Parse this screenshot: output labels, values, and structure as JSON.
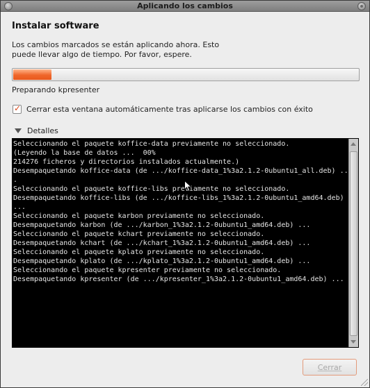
{
  "window": {
    "title": "Aplicando los cambios"
  },
  "heading": "Instalar software",
  "description": "Los cambios marcados se están aplicando ahora. Esto puede llevar algo de tiempo. Por favor, espere.",
  "progress": {
    "fraction": 0.11,
    "fill_color": "#f0662a"
  },
  "status_text": "Preparando kpresenter",
  "auto_close": {
    "checked": true,
    "label": "Cerrar esta ventana automáticamente tras aplicarse los cambios con éxito"
  },
  "details": {
    "label": "Detalles",
    "expanded": true
  },
  "terminal_lines": [
    "Seleccionando el paquete koffice-data previamente no seleccionado.",
    "(Leyendo la base de datos ...  00%",
    "214276 ficheros y directorios instalados actualmente.)",
    "Desempaquetando koffice-data (de .../koffice-data_1%3a2.1.2-0ubuntu1_all.deb) ..",
    ".",
    "Seleccionando el paquete koffice-libs previamente no seleccionado.",
    "Desempaquetando koffice-libs (de .../koffice-libs_1%3a2.1.2-0ubuntu1_amd64.deb) ..",
    "...",
    "Seleccionando el paquete karbon previamente no seleccionado.",
    "Desempaquetando karbon (de .../karbon_1%3a2.1.2-0ubuntu1_amd64.deb) ...",
    "Seleccionando el paquete kchart previamente no seleccionado.",
    "Desempaquetando kchart (de .../kchart_1%3a2.1.2-0ubuntu1_amd64.deb) ...",
    "Seleccionando el paquete kplato previamente no seleccionado.",
    "Desempaquetando kplato (de .../kplato_1%3a2.1.2-0ubuntu1_amd64.deb) ...",
    "Seleccionando el paquete kpresenter previamente no seleccionado.",
    "Desempaquetando kpresenter (de .../kpresenter_1%3a2.1.2-0ubuntu1_amd64.deb) ..."
  ],
  "buttons": {
    "close_label": "Cerrar",
    "close_enabled": false
  },
  "colors": {
    "accent": "#e8591d",
    "terminal_bg": "#000000",
    "terminal_fg": "#e6e6e6"
  }
}
